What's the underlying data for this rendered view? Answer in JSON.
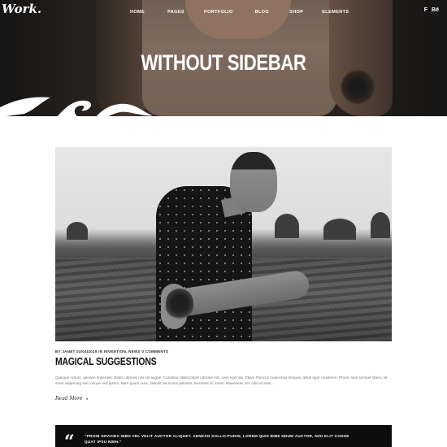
{
  "header": {
    "brand": "Work.",
    "nav": [
      "Home",
      "Pages",
      "Portfolio",
      "Blog",
      "Shop",
      "Elements"
    ],
    "social": [
      {
        "icon": "foursquare-icon",
        "glyph": "F"
      },
      {
        "icon": "behance-icon",
        "glyph": "Bē"
      }
    ]
  },
  "hero": {
    "title": "WITHOUT SIDEBAR"
  },
  "post": {
    "meta": "By Janet 03/04/2019 in Invention, News 0 Comments",
    "title": "MAGICAL SUGGESTIONS",
    "excerpt": "Quisque rutrum, aenean imperdiet. Etiam ultricies nisi vel augue. Curabitur ullamcorper ultricies nisi, nam eget dui. Etiam rhoncus maecenas tempus, tellus eget condimen. Rhonc sem semper libero, sit amet adipiscing sem neque sed ipsum. Nam quam nunc, blandit vel luctus pulvinar, hendrerit id, lorem. Maecenas nec odio et ante, ...",
    "read_more": "Read More"
  },
  "quote": {
    "mark": "“",
    "text": "“Proin gravida nibh vel velit auctor aliquet. Aenean sollicitudin, lorem quis bibe ndum auctor, nisi elit conse quat ipsu nibh.”"
  },
  "colors": {
    "accent": "#000000",
    "text": "#111111",
    "muted": "#777777",
    "quote_bg": "#0d0d0d"
  }
}
